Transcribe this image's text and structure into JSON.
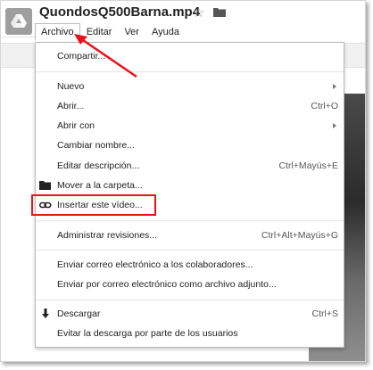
{
  "header": {
    "title": "QuondosQ500Barna.mp4",
    "logo_icon": "google-drive-icon",
    "star_icon": "star-outline-icon",
    "folder_icon": "folder-icon"
  },
  "menubar": {
    "items": [
      {
        "label": "Archivo",
        "active": true
      },
      {
        "label": "Editar",
        "active": false
      },
      {
        "label": "Ver",
        "active": false
      },
      {
        "label": "Ayuda",
        "active": false
      }
    ]
  },
  "file_menu": {
    "items": [
      {
        "label": "Compartir...",
        "shortcut": ""
      },
      {
        "label": "Nuevo",
        "shortcut": "",
        "submenu": true
      },
      {
        "label": "Abrir...",
        "shortcut": "Ctrl+O"
      },
      {
        "label": "Abrir con",
        "shortcut": "",
        "submenu": true
      },
      {
        "label": "Cambiar nombre...",
        "shortcut": ""
      },
      {
        "label": "Editar descripción...",
        "shortcut": "Ctrl+Mayús+E"
      },
      {
        "label": "Mover a la carpeta...",
        "shortcut": "",
        "icon": "folder-icon"
      },
      {
        "label": "Insertar este vídeo...",
        "shortcut": "",
        "icon": "link-icon"
      },
      {
        "label": "Administrar revisiones...",
        "shortcut": "Ctrl+Alt+Mayús+G"
      },
      {
        "label": "Enviar correo electrónico a los colaboradores...",
        "shortcut": ""
      },
      {
        "label": "Enviar por correo electrónico como archivo adjunto...",
        "shortcut": ""
      },
      {
        "label": "Descargar",
        "shortcut": "Ctrl+S",
        "icon": "download-arrow-icon"
      },
      {
        "label": "Evitar la descarga por parte de los usuarios",
        "shortcut": ""
      }
    ]
  },
  "annotations": {
    "highlight_color": "#e8131b",
    "arrow_color": "#e8131b"
  }
}
